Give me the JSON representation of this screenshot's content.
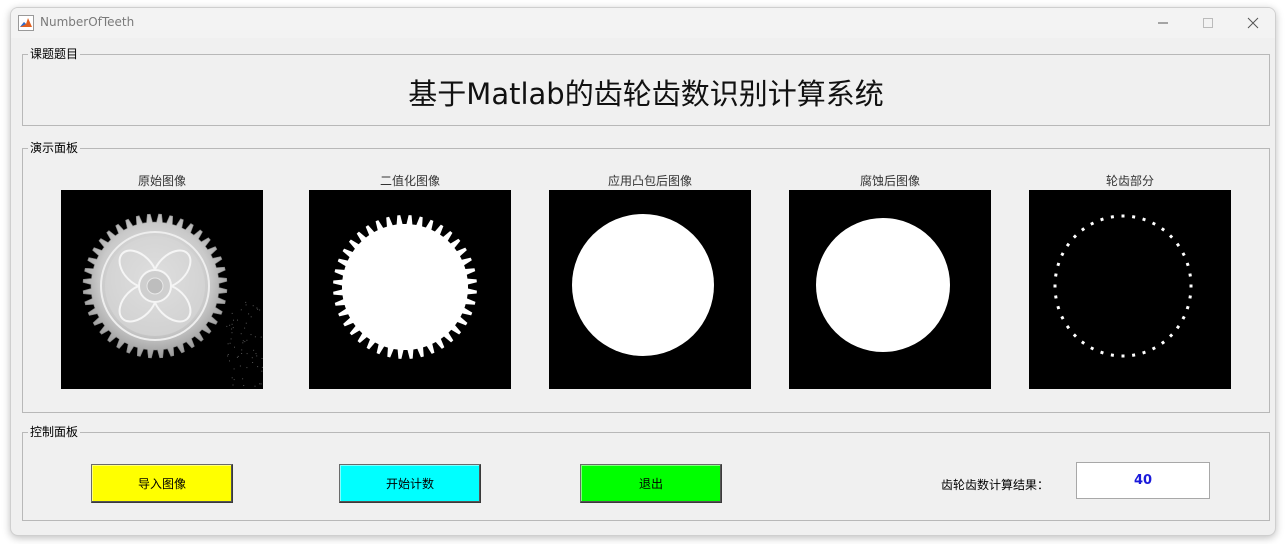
{
  "window": {
    "title": "NumberOfTeeth"
  },
  "topic_panel": {
    "label": "课题题目",
    "title": "基于Matlab的齿轮齿数识别计算系统"
  },
  "demo_panel": {
    "label": "演示面板",
    "images": [
      {
        "caption": "原始图像",
        "kind": "original-gear-photo"
      },
      {
        "caption": "二值化图像",
        "kind": "binary-gear"
      },
      {
        "caption": "应用凸包后图像",
        "kind": "convex-hull-disc"
      },
      {
        "caption": "腐蚀后图像",
        "kind": "eroded-disc"
      },
      {
        "caption": "轮齿部分",
        "kind": "teeth-ring"
      }
    ]
  },
  "control_panel": {
    "label": "控制面板",
    "buttons": {
      "import": {
        "label": "导入图像",
        "color": "#ffff00"
      },
      "start": {
        "label": "开始计数",
        "color": "#00ffff"
      },
      "exit": {
        "label": "退出",
        "color": "#00ff00"
      }
    },
    "result_label": "齿轮齿数计算结果：",
    "result_value": "40",
    "result_color": "#1a1adb"
  },
  "gear": {
    "teeth": 40
  }
}
